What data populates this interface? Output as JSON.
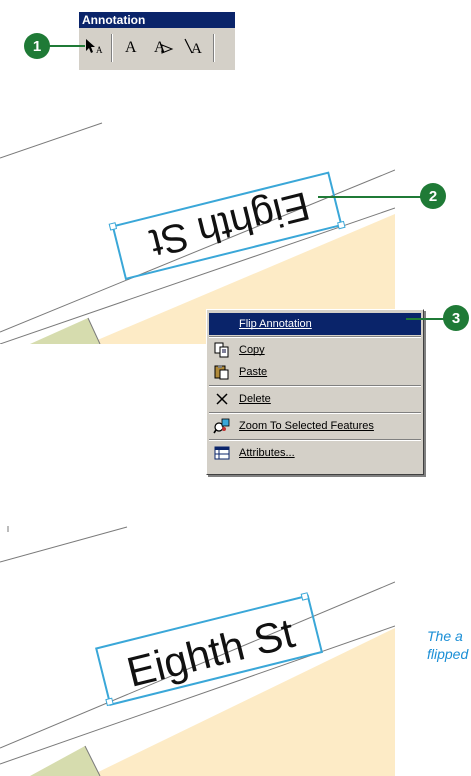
{
  "toolbar": {
    "title": "Annotation",
    "buttons": [
      {
        "icon": "select-annotation-icon"
      },
      {
        "icon": "horizontal-text-icon"
      },
      {
        "icon": "straight-text-icon"
      },
      {
        "icon": "curved-text-icon"
      }
    ]
  },
  "callouts": [
    "1",
    "2",
    "3"
  ],
  "maps": {
    "upper_label": "Eighth St",
    "lower_label": "Eighth St",
    "colors": {
      "parcel": "#fdebc6",
      "green": "#d6dcae",
      "road_line": "#7a7a7a",
      "selection": "#3aa7d8"
    }
  },
  "context_menu": {
    "items": [
      {
        "label": "Flip Annotation",
        "icon": "none",
        "highlighted": true
      },
      {
        "label": "Copy",
        "icon": "copy-icon"
      },
      {
        "label": "Paste",
        "icon": "paste-icon"
      },
      {
        "label": "Delete",
        "icon": "delete-icon"
      },
      {
        "label": "Zoom To Selected Features",
        "icon": "zoom-to-selected-icon"
      },
      {
        "label": "Attributes...",
        "icon": "attributes-icon"
      }
    ]
  },
  "caption": {
    "line1": "The a",
    "line2": "flipped"
  }
}
